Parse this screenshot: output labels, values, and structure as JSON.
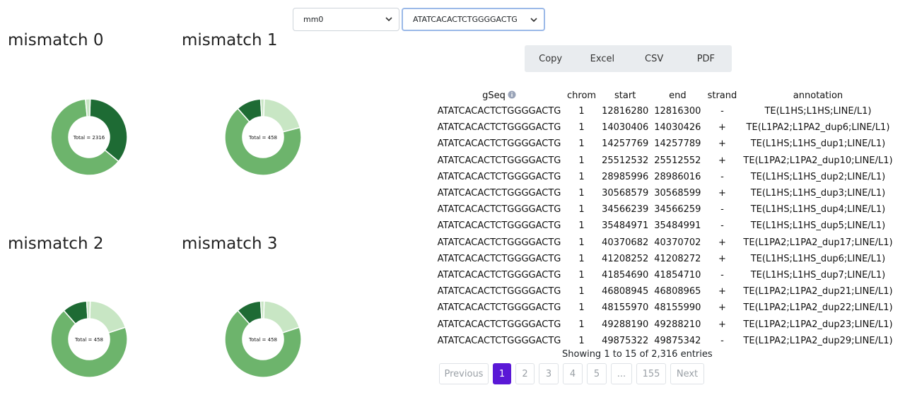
{
  "selects": {
    "genome": "mm0",
    "sequence": "ATATCACACTCTGGGGACTG"
  },
  "panels": [
    {
      "title": "mismatch 0",
      "total_label": "Total = 2316",
      "slices": [
        {
          "value": 0.355,
          "color": "#1e6b34"
        },
        {
          "value": 0.625,
          "color": "#6db46c"
        },
        {
          "value": 0.02,
          "color": "#c8e6c4"
        }
      ]
    },
    {
      "title": "mismatch 1",
      "total_label": "Total = 458",
      "slices": [
        {
          "value": 0.205,
          "color": "#c8e6c4"
        },
        {
          "value": 0.675,
          "color": "#6db46c"
        },
        {
          "value": 0.105,
          "color": "#1e6b34"
        },
        {
          "value": 0.015,
          "color": "#c8e6c4"
        }
      ]
    },
    {
      "title": "mismatch 2",
      "total_label": "Total = 458",
      "slices": [
        {
          "value": 0.195,
          "color": "#c8e6c4"
        },
        {
          "value": 0.685,
          "color": "#6db46c"
        },
        {
          "value": 0.105,
          "color": "#1e6b34"
        },
        {
          "value": 0.015,
          "color": "#c8e6c4"
        }
      ]
    },
    {
      "title": "mismatch 3",
      "total_label": "Total = 458",
      "slices": [
        {
          "value": 0.195,
          "color": "#c8e6c4"
        },
        {
          "value": 0.685,
          "color": "#6db46c"
        },
        {
          "value": 0.105,
          "color": "#1e6b34"
        },
        {
          "value": 0.015,
          "color": "#c8e6c4"
        }
      ]
    }
  ],
  "export_buttons": [
    "Copy",
    "Excel",
    "CSV",
    "PDF"
  ],
  "table": {
    "headers": {
      "gseq": "gSeq",
      "chrom": "chrom",
      "start": "start",
      "end": "end",
      "strand": "strand",
      "annotation": "annotation"
    },
    "rows": [
      [
        "ATATCACACTCTGGGGACTG",
        "1",
        "12816280",
        "12816300",
        "-",
        "TE(L1HS;L1HS;LINE/L1)"
      ],
      [
        "ATATCACACTCTGGGGACTG",
        "1",
        "14030406",
        "14030426",
        "+",
        "TE(L1PA2;L1PA2_dup6;LINE/L1)"
      ],
      [
        "ATATCACACTCTGGGGACTG",
        "1",
        "14257769",
        "14257789",
        "+",
        "TE(L1HS;L1HS_dup1;LINE/L1)"
      ],
      [
        "ATATCACACTCTGGGGACTG",
        "1",
        "25512532",
        "25512552",
        "+",
        "TE(L1PA2;L1PA2_dup10;LINE/L1)"
      ],
      [
        "ATATCACACTCTGGGGACTG",
        "1",
        "28985996",
        "28986016",
        "-",
        "TE(L1HS;L1HS_dup2;LINE/L1)"
      ],
      [
        "ATATCACACTCTGGGGACTG",
        "1",
        "30568579",
        "30568599",
        "+",
        "TE(L1HS;L1HS_dup3;LINE/L1)"
      ],
      [
        "ATATCACACTCTGGGGACTG",
        "1",
        "34566239",
        "34566259",
        "-",
        "TE(L1HS;L1HS_dup4;LINE/L1)"
      ],
      [
        "ATATCACACTCTGGGGACTG",
        "1",
        "35484971",
        "35484991",
        "-",
        "TE(L1HS;L1HS_dup5;LINE/L1)"
      ],
      [
        "ATATCACACTCTGGGGACTG",
        "1",
        "40370682",
        "40370702",
        "+",
        "TE(L1PA2;L1PA2_dup17;LINE/L1)"
      ],
      [
        "ATATCACACTCTGGGGACTG",
        "1",
        "41208252",
        "41208272",
        "+",
        "TE(L1HS;L1HS_dup6;LINE/L1)"
      ],
      [
        "ATATCACACTCTGGGGACTG",
        "1",
        "41854690",
        "41854710",
        "-",
        "TE(L1HS;L1HS_dup7;LINE/L1)"
      ],
      [
        "ATATCACACTCTGGGGACTG",
        "1",
        "46808945",
        "46808965",
        "+",
        "TE(L1PA2;L1PA2_dup21;LINE/L1)"
      ],
      [
        "ATATCACACTCTGGGGACTG",
        "1",
        "48155970",
        "48155990",
        "+",
        "TE(L1PA2;L1PA2_dup22;LINE/L1)"
      ],
      [
        "ATATCACACTCTGGGGACTG",
        "1",
        "49288190",
        "49288210",
        "+",
        "TE(L1PA2;L1PA2_dup23;LINE/L1)"
      ],
      [
        "ATATCACACTCTGGGGACTG",
        "1",
        "49875322",
        "49875342",
        "-",
        "TE(L1PA2;L1PA2_dup29;LINE/L1)"
      ]
    ]
  },
  "info": "Showing 1 to 15 of 2,316 entries",
  "pagination": {
    "previous": "Previous",
    "pages": [
      "1",
      "2",
      "3",
      "4",
      "5",
      "...",
      "155"
    ],
    "active": "1",
    "next": "Next"
  },
  "colors": {
    "dark_green": "#1e6b34",
    "mid_green": "#6db46c",
    "light_green": "#c8e6c4",
    "accent": "#5a18d6"
  }
}
